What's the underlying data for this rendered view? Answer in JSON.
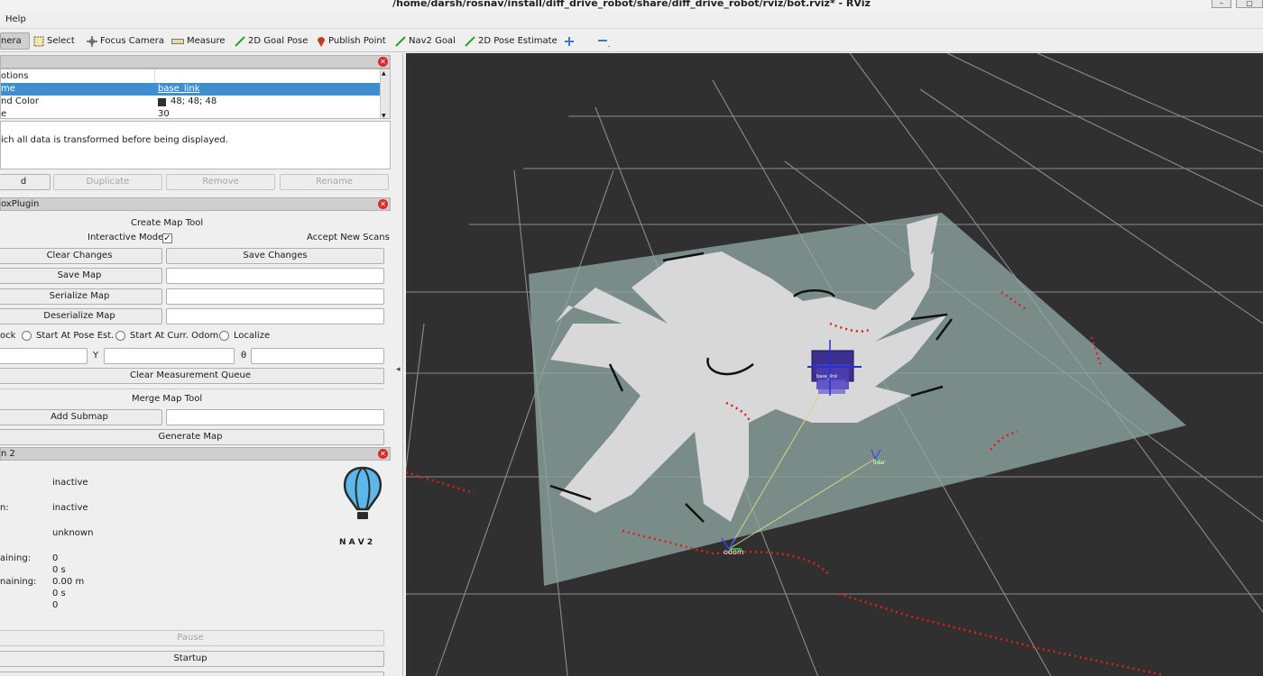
{
  "window": {
    "title": "/home/darsh/rosnav/install/diff_drive_robot/share/diff_drive_robot/rviz/bot.rviz* - RViz"
  },
  "menu": {
    "help": "Help"
  },
  "toolbar": {
    "camera": "nera",
    "select": "Select",
    "focus_camera": "Focus Camera",
    "measure": "Measure",
    "goal_pose": "2D Goal Pose",
    "publish_point": "Publish Point",
    "nav2_goal": "Nav2 Goal",
    "pose_estimate": "2D Pose Estimate"
  },
  "displays_panel": {
    "options_header": "otions",
    "rows": [
      {
        "name": "me",
        "value": "base_link"
      },
      {
        "name": "nd Color",
        "value": "48; 48; 48"
      },
      {
        "name": "e",
        "value": "30"
      }
    ],
    "description": "ich all data is transformed before being displayed.",
    "buttons": {
      "add": "d",
      "duplicate": "Duplicate",
      "remove": "Remove",
      "rename": "Rename"
    }
  },
  "slam_panel": {
    "title": "oxPlugin",
    "create_map_tool": "Create Map Tool",
    "interactive_mode": "Interactive Mode",
    "interactive_checked": "✓",
    "accept_new_scans": "Accept New Scans",
    "clear_changes": "Clear Changes",
    "save_changes": "Save Changes",
    "save_map": "Save Map",
    "serialize_map": "Serialize Map",
    "deserialize_map": "Deserialize Map",
    "radio_lock": "ock",
    "radio_pose_est": "Start At Pose Est.",
    "radio_curr_odom": "Start At Curr. Odom",
    "radio_localize": "Localize",
    "y_label": "Y",
    "theta_label": "θ",
    "clear_measurement": "Clear Measurement Queue",
    "merge_map_tool": "Merge Map Tool",
    "add_submap": "Add Submap",
    "generate_map": "Generate Map"
  },
  "nav2_panel": {
    "title": "n 2",
    "rows": [
      {
        "label": "",
        "value": "inactive"
      },
      {
        "label": "n:",
        "value": "inactive"
      },
      {
        "label": "",
        "value": "unknown"
      },
      {
        "label": "aining:",
        "value": "0"
      },
      {
        "label": "",
        "value": "0 s"
      },
      {
        "label": "naining:",
        "value": "0.00 m"
      },
      {
        "label": "",
        "value": "0 s"
      },
      {
        "label": "",
        "value": "0"
      }
    ],
    "logo_text": "N A V 2",
    "pause": "Pause",
    "startup": "Startup"
  },
  "viewport": {
    "background_color": "#303030",
    "frame_odom": "odom",
    "frame_base": "base_link",
    "frame_lidar": "lidar"
  }
}
